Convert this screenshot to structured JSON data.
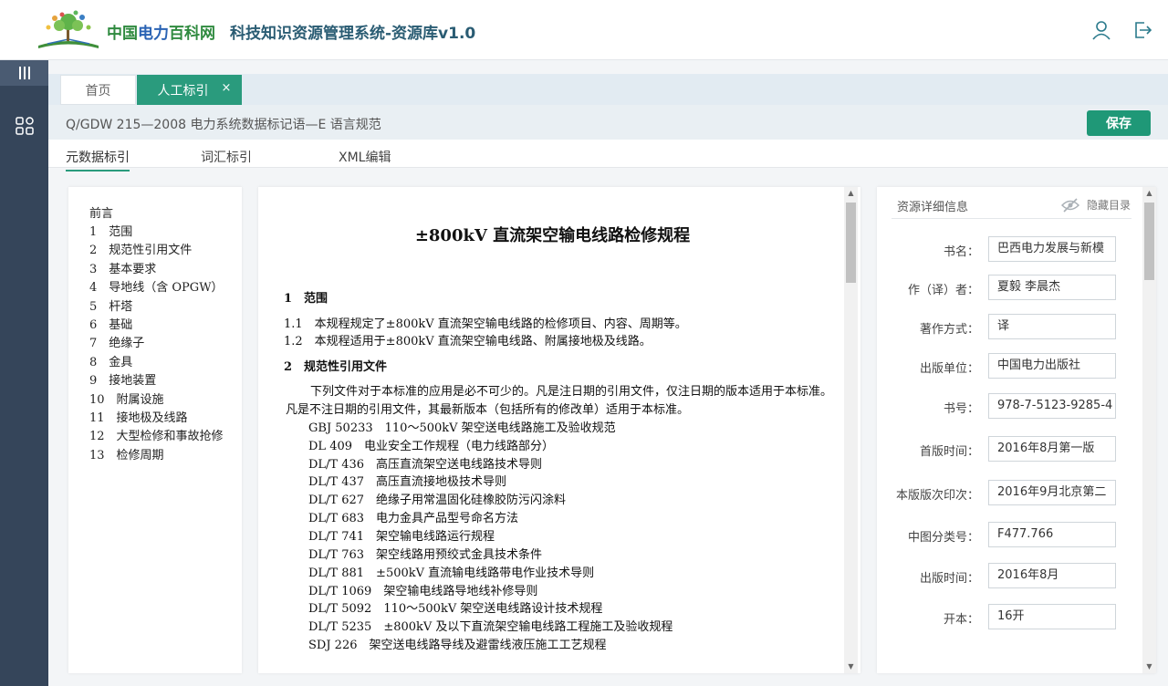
{
  "header": {
    "brand_part1": "中国",
    "brand_part2": "电力",
    "brand_part3": "百科网",
    "system_title": "科技知识资源管理系统-资源库v1.0",
    "user_icon": "user-icon",
    "logout_icon": "logout-icon"
  },
  "sidebar": {
    "items": [
      {
        "icon": "menu-bars-icon"
      },
      {
        "icon": "grid-apps-icon"
      }
    ]
  },
  "tabs": [
    {
      "label": "首页",
      "active": false
    },
    {
      "label": "人工标引",
      "active": true,
      "close": "×"
    }
  ],
  "document": {
    "name": "Q/GDW 215—2008 电力系统数据标记语—E 语言规范",
    "save_label": "保存"
  },
  "subtabs": [
    {
      "label": "元数据标引",
      "active": true
    },
    {
      "label": "词汇标引",
      "active": false
    },
    {
      "label": "XML编辑",
      "active": false
    }
  ],
  "toc": [
    "前言",
    "1　范围",
    "2　规范性引用文件",
    "3　基本要求",
    "4　导地线（含 OPGW）",
    "5　杆塔",
    "6　基础",
    "7　绝缘子",
    "8　金具",
    "9　接地装置",
    "10　附属设施",
    "11　接地极及线路",
    "12　大型检修和事故抢修",
    "13　检修周期"
  ],
  "content": {
    "title": "±800kV 直流架空输电线路检修规程",
    "lines": [
      {
        "text": "1　范围",
        "kind": "h"
      },
      {
        "text": "1.1　本规程规定了±800kV 直流架空输电线路的检修项目、内容、周期等。",
        "kind": "p"
      },
      {
        "text": "1.2　本规程适用于±800kV 直流架空输电线路、附属接地极及线路。",
        "kind": "p"
      },
      {
        "text": "2　规范性引用文件",
        "kind": "h"
      },
      {
        "text": "下列文件对于本标准的应用是必不可少的。凡是注日期的引用文件，仅注日期的版本适用于本标准。",
        "kind": "indent"
      },
      {
        "text": "凡是不注日期的引用文件，其最新版本（包括所有的修改单）适用于本标准。",
        "kind": "p"
      },
      {
        "text": "GBJ 50233　110～500kV 架空送电线路施工及验收规范",
        "kind": "ref"
      },
      {
        "text": "DL 409　电业安全工作规程（电力线路部分）",
        "kind": "ref"
      },
      {
        "text": "DL/T 436　高压直流架空送电线路技术导则",
        "kind": "ref"
      },
      {
        "text": "DL/T 437　高压直流接地极技术导则",
        "kind": "ref"
      },
      {
        "text": "DL/T 627　绝缘子用常温固化硅橡胶防污闪涂料",
        "kind": "ref"
      },
      {
        "text": "DL/T 683　电力金具产品型号命名方法",
        "kind": "ref"
      },
      {
        "text": "DL/T 741　架空输电线路运行规程",
        "kind": "ref"
      },
      {
        "text": "DL/T 763　架空线路用预绞式金具技术条件",
        "kind": "ref"
      },
      {
        "text": "DL/T 881　±500kV 直流输电线路带电作业技术导则",
        "kind": "ref"
      },
      {
        "text": "DL/T 1069　架空输电线路导地线补修导则",
        "kind": "ref"
      },
      {
        "text": "DL/T 5092　110～500kV 架空送电线路设计技术规程",
        "kind": "ref"
      },
      {
        "text": "DL/T 5235　±800kV 及以下直流架空输电线路工程施工及验收规程",
        "kind": "ref"
      },
      {
        "text": "SDJ 226　架空送电线路导线及避雷线液压施工工艺规程",
        "kind": "ref"
      }
    ]
  },
  "detail": {
    "heading": "资源详细信息",
    "hide_toc_label": "隐藏目录",
    "hide_icon": "eye-off-icon",
    "fields": [
      {
        "label": "书名：",
        "value": "巴西电力发展与新模"
      },
      {
        "label": "作（译）者：",
        "value": "夏毅 李晨杰"
      },
      {
        "label": "著作方式：",
        "value": "译"
      },
      {
        "label": "出版单位：",
        "value": "中国电力出版社"
      },
      {
        "label": "书号：",
        "value": "978-7-5123-9285-4"
      },
      {
        "label": "首版时间：",
        "value": "2016年8月第一版"
      },
      {
        "label": "本版版次印次：",
        "value": "2016年9月北京第二"
      },
      {
        "label": "中图分类号：",
        "value": "F477.766"
      },
      {
        "label": "出版时间：",
        "value": "2016年8月"
      },
      {
        "label": "开本：",
        "value": "16开"
      }
    ]
  },
  "colors": {
    "accent": "#2a9b7d",
    "sidebar": "#35455a",
    "brand_green": "#2f8a3f",
    "brand_blue": "#2a63b4"
  }
}
